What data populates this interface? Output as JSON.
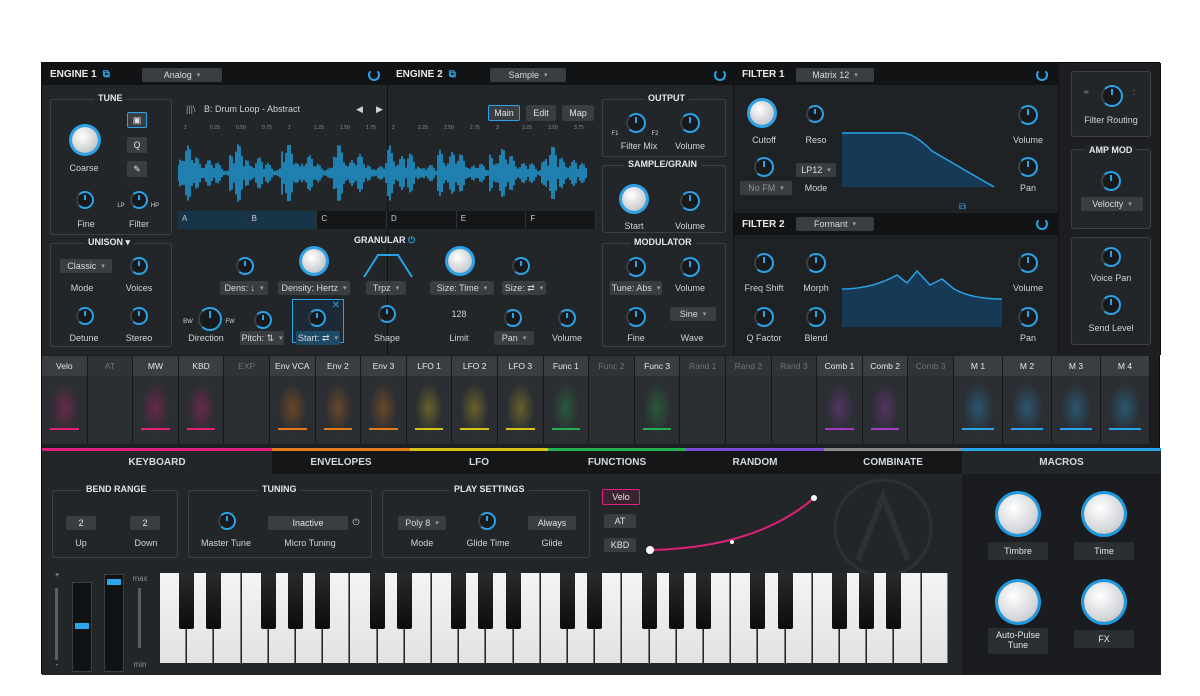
{
  "engine1": {
    "title": "ENGINE 1",
    "type": "Analog"
  },
  "engine2": {
    "title": "ENGINE 2",
    "type": "Sample"
  },
  "tune": {
    "title": "TUNE",
    "coarse": "Coarse",
    "fine": "Fine",
    "filter": "Filter",
    "q": "Q",
    "lp": "LP",
    "hp": "HP"
  },
  "unison": {
    "title": "UNISON",
    "mode_value": "Classic",
    "mode": "Mode",
    "voices": "Voices",
    "detune": "Detune",
    "stereo": "Stereo"
  },
  "sample": {
    "name": "B: Drum Loop - Abstract",
    "views": [
      "Main",
      "Edit",
      "Map"
    ],
    "ticks": [
      "1",
      "0.25",
      "0.50",
      "0.75",
      "1",
      "1.25",
      "1.50",
      "1.75",
      "2",
      "2.25",
      "2.50",
      "2.75",
      "3",
      "3.25",
      "3.50",
      "3.75"
    ],
    "slots": [
      "A",
      "B",
      "C",
      "D",
      "E",
      "F"
    ]
  },
  "output": {
    "title": "OUTPUT",
    "filter_mix": "Filter Mix",
    "volume": "Volume",
    "f1": "F1",
    "f2": "F2"
  },
  "sample_grain": {
    "title": "SAMPLE/GRAIN",
    "start": "Start",
    "volume": "Volume"
  },
  "granular": {
    "title": "GRANULAR",
    "dens": "Dens: ↓",
    "density": "Density: Hertz",
    "trpz": "Trpz",
    "size_time": "Size: Time",
    "size": "Size: ⇄",
    "direction": "Direction",
    "pitch": "Pitch: ⇅",
    "start": "Start: ⇄",
    "shape": "Shape",
    "limit_value": "128",
    "limit": "Limit",
    "pan": "Pan",
    "volume": "Volume",
    "bw": "BW",
    "fw": "FW"
  },
  "modulator": {
    "title": "MODULATOR",
    "tune": "Tune: Abs",
    "volume": "Volume",
    "fine": "Fine",
    "wave_value": "Sine",
    "wave": "Wave"
  },
  "filter1": {
    "title": "FILTER 1",
    "type": "Matrix 12",
    "cutoff": "Cutoff",
    "reso": "Reso",
    "lp": "LP12",
    "fm": "No FM",
    "mode": "Mode",
    "volume": "Volume",
    "pan": "Pan"
  },
  "filter2": {
    "title": "FILTER 2",
    "type": "Formant",
    "freq_shift": "Freq Shift",
    "morph": "Morph",
    "q_factor": "Q Factor",
    "blend": "Blend",
    "volume": "Volume",
    "pan": "Pan"
  },
  "right": {
    "filter_routing": "Filter Routing",
    "amp_mod": "AMP MOD",
    "velocity": "Velocity",
    "voice_pan": "Voice Pan",
    "send_level": "Send Level"
  },
  "mod_sources": [
    "Velo",
    "AT",
    "MW",
    "KBD",
    "EXP",
    "Env VCA",
    "Env 2",
    "Env 3",
    "LFO 1",
    "LFO 2",
    "LFO 3",
    "Func 1",
    "Func 2",
    "Func 3",
    "Rand 1",
    "Rand 2",
    "Rand 3",
    "Comb 1",
    "Comb 2",
    "Comb 3",
    "M 1",
    "M 2",
    "M 3",
    "M 4"
  ],
  "tabs": [
    "KEYBOARD",
    "ENVELOPES",
    "LFO",
    "FUNCTIONS",
    "RANDOM",
    "COMBINATE",
    "MACROS"
  ],
  "keyboard": {
    "bend_title": "BEND RANGE",
    "up_value": "2",
    "down_value": "2",
    "up": "Up",
    "down": "Down",
    "tuning_title": "TUNING",
    "master_tune": "Master Tune",
    "micro_value": "Inactive",
    "micro_tuning": "Micro Tuning",
    "play_title": "PLAY SETTINGS",
    "poly": "Poly 8",
    "mode": "Mode",
    "glide_time": "Glide Time",
    "always": "Always",
    "glide": "Glide",
    "velo": "Velo",
    "at": "AT",
    "kbd": "KBD",
    "max": "max",
    "min": "min",
    "plus": "+",
    "minus": "-"
  },
  "macros": {
    "timbre": "Timbre",
    "time": "Time",
    "autopulse": "Auto-Pulse Tune",
    "fx": "FX"
  },
  "colors": {
    "accent": "#2aa3e8",
    "keyboard": "#e0207a",
    "envelopes": "#e07a1a",
    "lfo": "#d8c21a",
    "functions": "#25b050",
    "random": "#7a4ad0",
    "combinate": "#8a8a8a",
    "macros": "#2aa3e8"
  }
}
